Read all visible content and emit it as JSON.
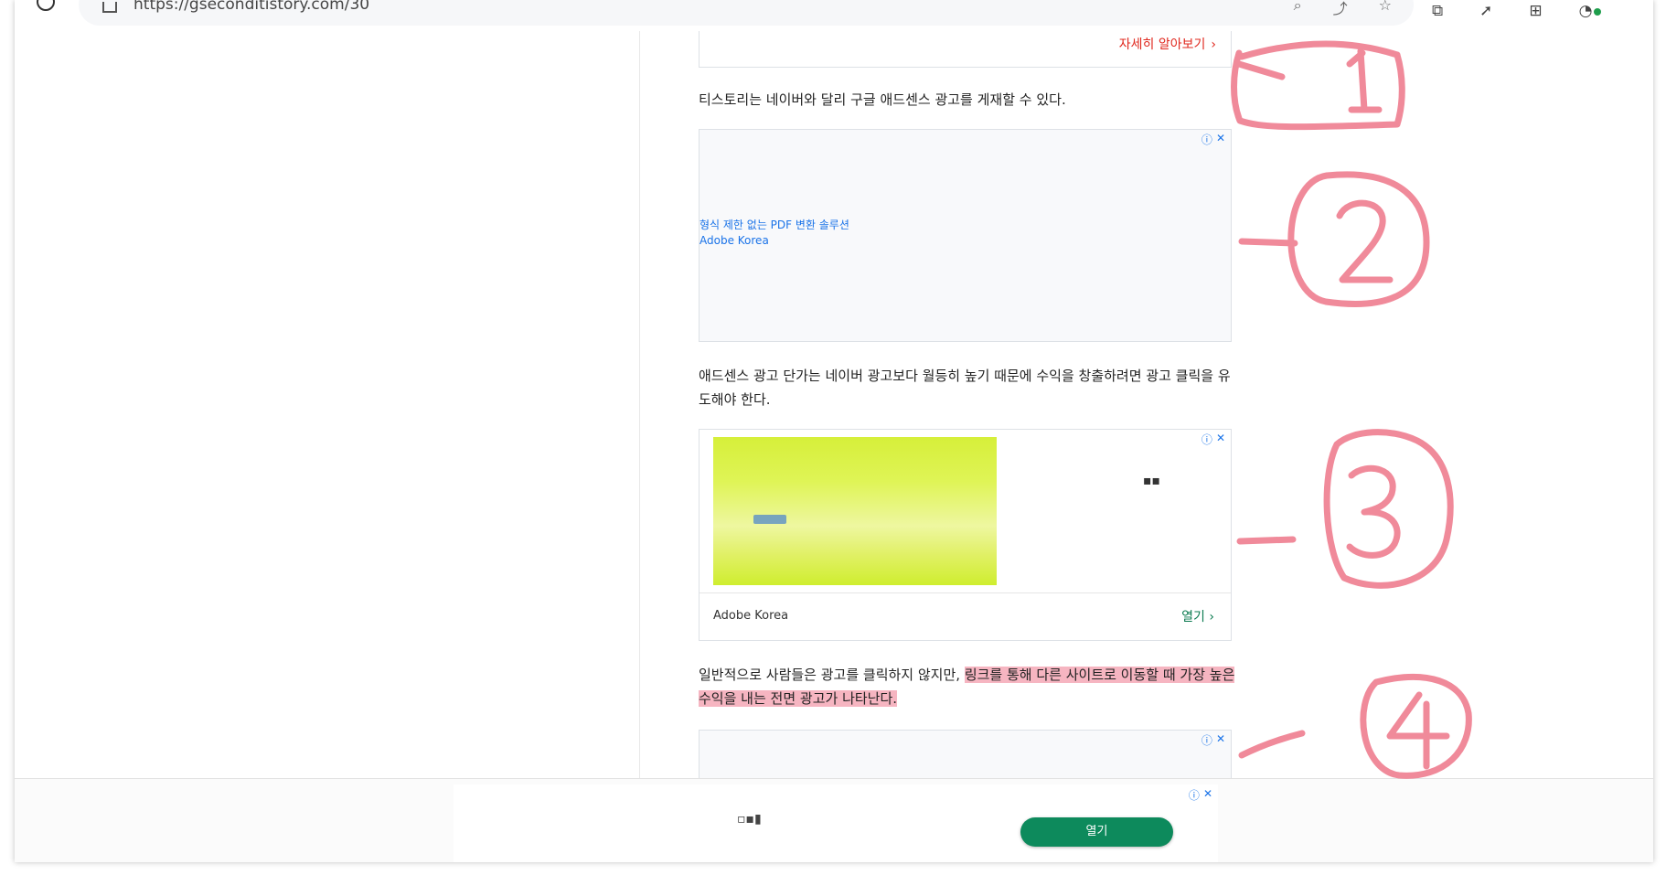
{
  "browser": {
    "url": "https://gseconditistory.com/30"
  },
  "ads": {
    "top_learn_more": "자세히 알아보기",
    "info_symbol": "ⓘ",
    "close_symbol": "✕",
    "ad2_title": "형식 제한 없는 PDF 변환 솔루션",
    "ad2_brand": "Adobe Korea",
    "ad3_brand": "Adobe Korea",
    "ad3_open": "열기",
    "bottom_open": "열기"
  },
  "article": {
    "para1": "티스토리는 네이버와 달리 구글 애드센스 광고를 게재할 수 있다.",
    "para2": "애드센스 광고 단가는 네이버 광고보다 월등히 높기 때문에 수익을 창출하려면 광고 클릭을 유도해야 한다.",
    "para3_plain": "일반적으로 사람들은 광고를 클릭하지 않지만, ",
    "para3_highlight": "링크를 통해 다른 사이트로 이동할 때 가장 높은 수익을 내는 전면 광고가 나타난다."
  },
  "annotations": {
    "circle_1": "1",
    "circle_2": "2",
    "circle_3": "3",
    "circle_4": "4",
    "color": "#f08a9a"
  },
  "icons": [
    "reload-icon",
    "lock-icon",
    "search-icon",
    "star-icon",
    "chevron-right-icon",
    "info-icon",
    "close-icon"
  ]
}
